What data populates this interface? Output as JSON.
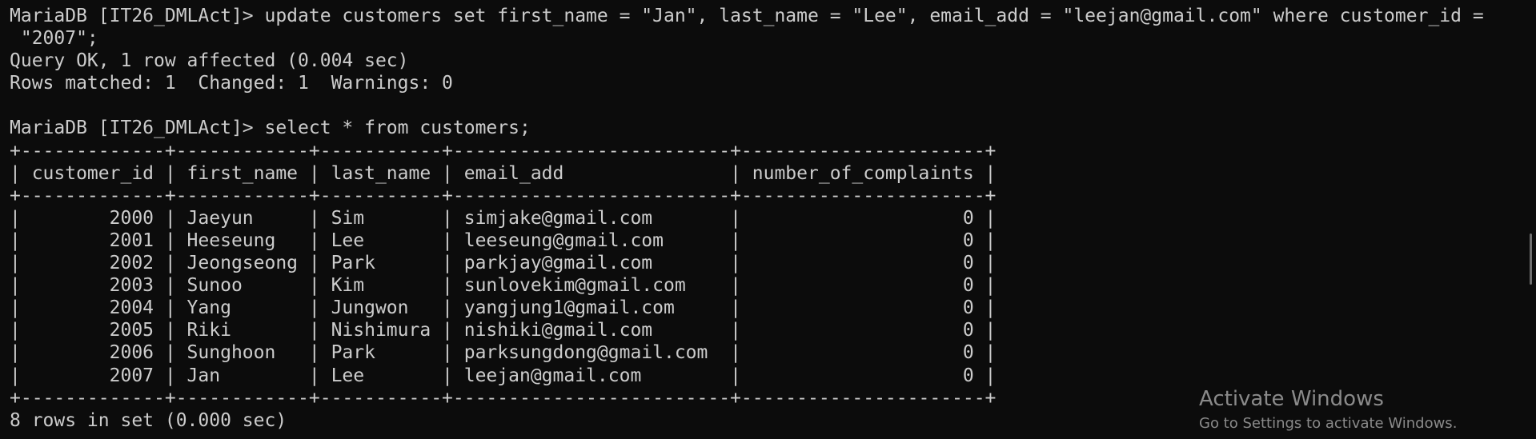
{
  "terminal": {
    "lines": [
      "MariaDB [IT26_DMLAct]> update customers set first_name = \"Jan\", last_name = \"Lee\", email_add = \"leejan@gmail.com\" where customer_id =",
      " \"2007\";",
      "Query OK, 1 row affected (0.004 sec)",
      "Rows matched: 1  Changed: 1  Warnings: 0",
      "",
      "MariaDB [IT26_DMLAct]> select * from customers;",
      "+-------------+------------+-----------+-------------------------+----------------------+",
      "| customer_id | first_name | last_name | email_add               | number_of_complaints |",
      "+-------------+------------+-----------+-------------------------+----------------------+",
      "|        2000 | Jaeyun     | Sim       | simjake@gmail.com       |                    0 |",
      "|        2001 | Heeseung   | Lee       | leeseung@gmail.com      |                    0 |",
      "|        2002 | Jeongseong | Park      | parkjay@gmail.com       |                    0 |",
      "|        2003 | Sunoo      | Kim       | sunlovekim@gmail.com    |                    0 |",
      "|        2004 | Yang       | Jungwon   | yangjung1@gmail.com     |                    0 |",
      "|        2005 | Riki       | Nishimura | nishiki@gmail.com       |                    0 |",
      "|        2006 | Sunghoon   | Park      | parksungdong@gmail.com  |                    0 |",
      "|        2007 | Jan        | Lee       | leejan@gmail.com        |                    0 |",
      "+-------------+------------+-----------+-------------------------+----------------------+",
      "8 rows in set (0.000 sec)"
    ]
  },
  "watermark": {
    "title": "Activate Windows",
    "subtitle": "Go to Settings to activate Windows."
  },
  "colors": {
    "background": "#0c0c0c",
    "text": "#cccccc",
    "watermark": "#8a8a8a"
  }
}
